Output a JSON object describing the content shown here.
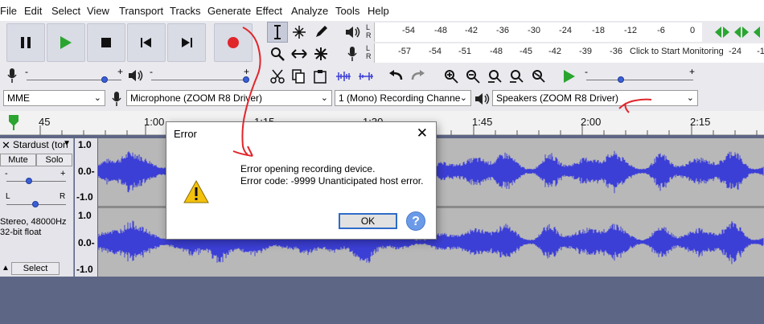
{
  "menu": [
    "File",
    "Edit",
    "Select",
    "View",
    "Transport",
    "Tracks",
    "Generate",
    "Effect",
    "Analyze",
    "Tools",
    "Help"
  ],
  "meters": {
    "playback_ticks": [
      "-54",
      "-48",
      "-42",
      "-36",
      "-30",
      "-24",
      "-18",
      "-12",
      "-6",
      "0"
    ],
    "record_ticks": [
      "-57",
      "-54",
      "-51",
      "-48",
      "-45",
      "-42",
      "-39",
      "-36"
    ],
    "record_ticks_right": [
      "-24",
      "-1"
    ],
    "monitor_text": "Click to Start Monitoring",
    "L": "L",
    "R": "R"
  },
  "sliders": {
    "minus": "-",
    "plus": "+"
  },
  "devices": {
    "host": "MME",
    "mic": "Microphone (ZOOM R8 Driver)",
    "channels": "1 (Mono) Recording Channe",
    "speakers": "Speakers (ZOOM R8 Driver)"
  },
  "timeline": {
    "labels": [
      "45",
      "1:00",
      "1:15",
      "1:30",
      "1:45",
      "2:00",
      "2:15"
    ]
  },
  "track": {
    "name": "Stardust (ton",
    "mute": "Mute",
    "solo": "Solo",
    "pan_l": "L",
    "pan_r": "R",
    "info1": "Stereo, 48000Hz",
    "info2": "32-bit float",
    "select": "Select",
    "scale": [
      "1.0",
      "0.0-",
      "-1.0",
      "1.0",
      "0.0-",
      "-1.0"
    ]
  },
  "dialog": {
    "title": "Error",
    "message1": "Error opening recording device.",
    "message2": "Error code: -9999 Unanticipated host error.",
    "ok": "OK",
    "help": "?"
  },
  "colors": {
    "wave": "#3c3fd6",
    "wave_bg": "#b8b8b8",
    "record": "#e0262b",
    "play": "#2aa52f",
    "annotation": "#e0262b"
  }
}
